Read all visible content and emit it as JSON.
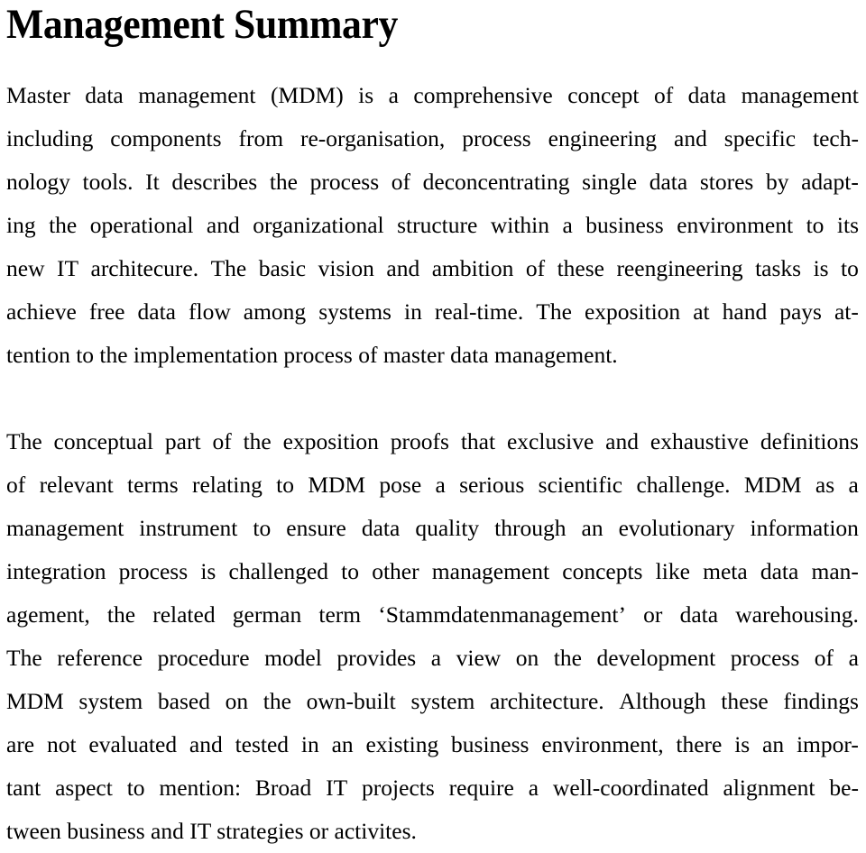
{
  "document": {
    "title": "Management Summary",
    "background_color": "#ffffff",
    "text_color": "#000000"
  },
  "paragraphs": [
    {
      "id": "paragraph-1",
      "text": "Master data management (MDM) is a comprehensive concept of data management including components from re-organisation, process engineering and specific technology tools. It describes the process of deconcentrating single data stores by adapting the operational and organizational structure within a business environment to its new IT architecure. The basic vision and ambition of these reengineering tasks is to achieve free data flow among systems in real-time. The exposition at hand pays attention to the implementation process of master data management.",
      "lines": [
        {
          "words": [
            "Master",
            "data",
            "management",
            "(MDM)",
            "is",
            "a",
            "comprehensive",
            "concept",
            "of",
            "data",
            "management"
          ],
          "justified": true
        },
        {
          "words": [
            "including",
            "components",
            "from",
            "re-organisation,",
            "process",
            "engineering",
            "and",
            "specific",
            "tech-"
          ],
          "justified": true
        },
        {
          "words": [
            "nology",
            "tools.",
            "It",
            "describes",
            "the",
            "process",
            "of",
            "deconcentrating",
            "single",
            "data",
            "stores",
            "by",
            "adapt-"
          ],
          "justified": true
        },
        {
          "words": [
            "ing",
            "the",
            "operational",
            "and",
            "organizational",
            "structure",
            "within",
            "a",
            "business",
            "environment",
            "to",
            "its"
          ],
          "justified": true
        },
        {
          "words": [
            "new",
            "IT",
            "architecure.",
            "The",
            "basic",
            "vision",
            "and",
            "ambition",
            "of",
            "these",
            "reengineering",
            "tasks",
            "is",
            "to"
          ],
          "justified": true
        },
        {
          "words": [
            "achieve",
            "free",
            "data",
            "flow",
            "among",
            "systems",
            "in",
            "real-time.",
            "The",
            "exposition",
            "at",
            "hand",
            "pays",
            "at-"
          ],
          "justified": true
        },
        {
          "words": [
            "tention to the implementation process of master data management."
          ],
          "justified": false
        }
      ]
    },
    {
      "id": "paragraph-2",
      "text": "The conceptual part of the exposition proofs that exclusive and exhaustive definitions of relevant terms relating to MDM pose a serious scientific challenge. MDM as a management instrument to ensure data quality through an evolutionary information integration process is challenged to other management concepts like meta data management, the related german term ‘Stammdatenmanagement’ or data warehousing.",
      "lines": [
        {
          "words": [
            "The",
            "conceptual",
            "part",
            "of",
            "the",
            "exposition",
            "proofs",
            "that",
            "exclusive",
            "and",
            "exhaustive",
            "definitions"
          ],
          "justified": true
        },
        {
          "words": [
            "of",
            "relevant",
            "terms",
            "relating",
            "to",
            "MDM",
            "pose",
            "a",
            "serious",
            "scientific",
            "challenge.",
            "MDM",
            "as",
            "a"
          ],
          "justified": true
        },
        {
          "words": [
            "management",
            "instrument",
            "to",
            "ensure",
            "data",
            "quality",
            "through",
            "an",
            "evolutionary",
            "information"
          ],
          "justified": true
        },
        {
          "words": [
            "integration",
            "process",
            "is",
            "challenged",
            "to",
            "other",
            "management",
            "concepts",
            "like",
            "meta",
            "data",
            "man-"
          ],
          "justified": true
        },
        {
          "words": [
            "agement,",
            "the",
            "related",
            "german",
            "term",
            "‘Stammdatenmanagement’",
            "or",
            "data",
            "warehousing."
          ],
          "justified": true
        }
      ]
    },
    {
      "id": "paragraph-3",
      "text": "The reference procedure model provides a view on the development process of a MDM system based on the own-built system architecture. Although these findings are not evaluated and tested in an existing business environment, there is an important aspect to mention: Broad IT projects require a well-coordinated alignment between business and IT strategies or activites.",
      "lines": [
        {
          "words": [
            "The",
            "reference",
            "procedure",
            "model",
            "provides",
            "a",
            "view",
            "on",
            "the",
            "development",
            "process",
            "of",
            "a"
          ],
          "justified": true
        },
        {
          "words": [
            "MDM",
            "system",
            "based",
            "on",
            "the",
            "own-built",
            "system",
            "architecture.",
            "Although",
            "these",
            "findings"
          ],
          "justified": true
        },
        {
          "words": [
            "are",
            "not",
            "evaluated",
            "and",
            "tested",
            "in",
            "an",
            "existing",
            "business",
            "environment,",
            "there",
            "is",
            "an",
            "impor-"
          ],
          "justified": true
        },
        {
          "words": [
            "tant",
            "aspect",
            "to",
            "mention:",
            "Broad",
            "IT",
            "projects",
            "require",
            "a",
            "well-coordinated",
            "alignment",
            "be-"
          ],
          "justified": true
        },
        {
          "words": [
            "tween business and IT strategies or activites."
          ],
          "justified": false
        }
      ]
    }
  ]
}
